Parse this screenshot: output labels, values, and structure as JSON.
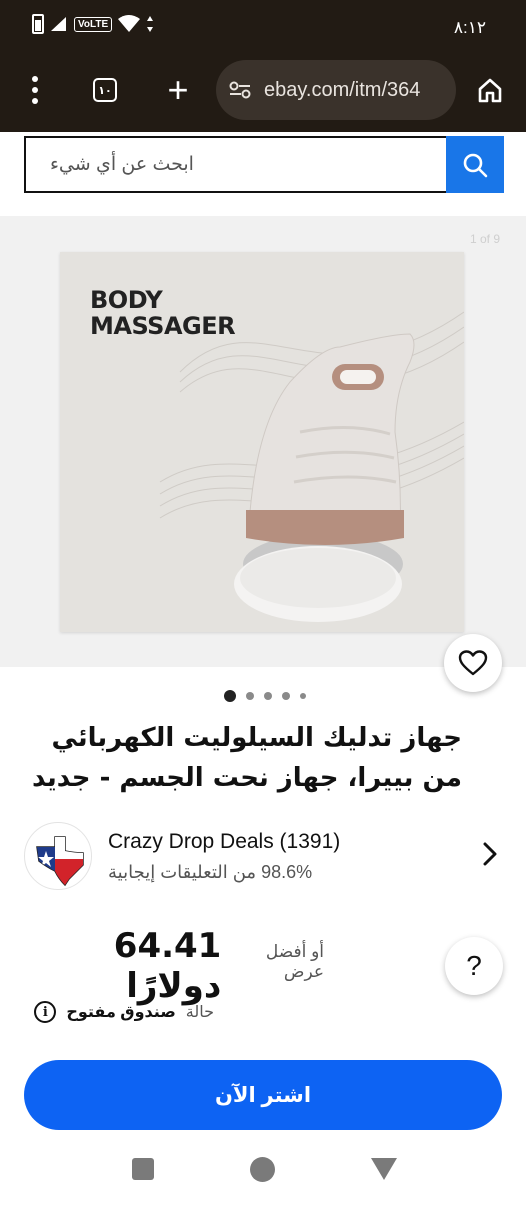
{
  "status_bar": {
    "time": "٨:١٢",
    "network": "VoLTE"
  },
  "browser": {
    "tab_count": "١٠",
    "url": "ebay.com/itm/364",
    "icons": [
      "menu-dots-icon",
      "tabs-icon",
      "plus-icon",
      "site-settings-icon",
      "home-icon"
    ]
  },
  "search": {
    "placeholder": "ابحث عن أي شيء"
  },
  "gallery": {
    "counter": "1 of 9",
    "box_text_line1": "BODY",
    "box_text_line2": "MASSAGER",
    "page_count": 5,
    "active_page": 1
  },
  "product": {
    "title": "جهاز تدليك السيلوليت الكهربائي من بييرا، جهاز نحت الجسم - جديد"
  },
  "seller": {
    "name": "Crazy Drop Deals (1391)",
    "feedback": "98.6% من التعليقات إيجابية"
  },
  "price": {
    "value": "64.41 دولارًا",
    "offer": "أو أفضل عرض"
  },
  "help": {
    "label": "?"
  },
  "condition": {
    "label": "حالة",
    "value": "صندوق مفتوح"
  },
  "buy": {
    "label": "اشتر الآن"
  },
  "colors": {
    "ebay_blue": "#0d63f3",
    "search_blue": "#1976e8",
    "chrome_bg": "#221b14"
  }
}
